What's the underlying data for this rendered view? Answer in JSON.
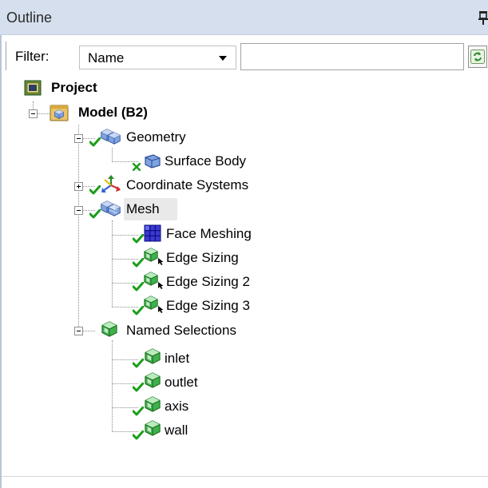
{
  "panel": {
    "title": "Outline"
  },
  "filter": {
    "label": "Filter:",
    "selected": "Name",
    "search_value": ""
  },
  "tree": {
    "project": "Project",
    "model": "Model (B2)",
    "geometry": "Geometry",
    "surface_body": "Surface Body",
    "coordinate_systems": "Coordinate Systems",
    "mesh": "Mesh",
    "face_meshing": "Face Meshing",
    "edge_sizing": "Edge Sizing",
    "edge_sizing_2": "Edge Sizing 2",
    "edge_sizing_3": "Edge Sizing 3",
    "named_selections": "Named Selections",
    "inlet": "inlet",
    "outlet": "outlet",
    "axis": "axis",
    "wall": "wall"
  },
  "colors": {
    "titlebar": "#d5dfed",
    "status_check": "#1a9e1a",
    "status_x": "#1a9e1a",
    "cube_blue": "#7fa3e0",
    "named_selection_green": "#3fb04a"
  },
  "icons": {
    "pin": "pin-icon",
    "refresh": "refresh-icon",
    "project": "project-icon",
    "model": "model-icon",
    "geometry": "geometry-icon",
    "surface_body": "surface-body-icon",
    "coordinate_systems": "coordinate-systems-icon",
    "mesh": "mesh-icon",
    "face_meshing": "face-meshing-icon",
    "edge_sizing": "edge-sizing-icon",
    "named_selection": "named-selection-icon"
  }
}
